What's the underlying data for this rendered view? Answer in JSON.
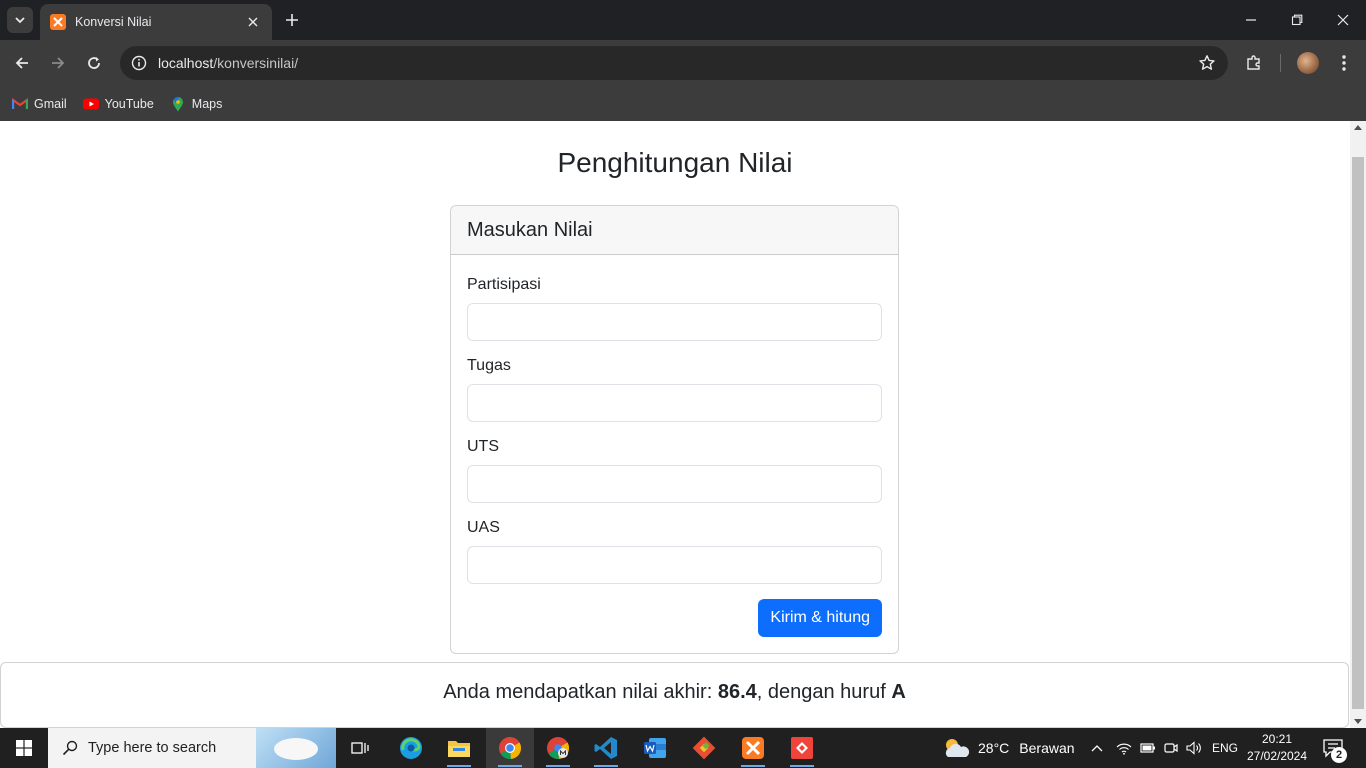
{
  "browser": {
    "tab_title": "Konversi Nilai",
    "url_host": "localhost",
    "url_path": "/konversinilai/",
    "bookmarks": [
      {
        "label": "Gmail",
        "icon": "gmail-icon"
      },
      {
        "label": "YouTube",
        "icon": "youtube-icon"
      },
      {
        "label": "Maps",
        "icon": "maps-icon"
      }
    ]
  },
  "page": {
    "title": "Penghitungan Nilai",
    "card_header": "Masukan Nilai",
    "fields": [
      {
        "label": "Partisipasi",
        "value": ""
      },
      {
        "label": "Tugas",
        "value": ""
      },
      {
        "label": "UTS",
        "value": ""
      },
      {
        "label": "UAS",
        "value": ""
      }
    ],
    "submit_label": "Kirim & hitung",
    "result": {
      "prefix": "Anda mendapatkan nilai akhir: ",
      "score": "86.4",
      "middle": ", dengan huruf ",
      "grade": "A"
    }
  },
  "taskbar": {
    "search_placeholder": "Type here to search",
    "weather_temp": "28°C",
    "weather_text": "Berawan",
    "language": "ENG",
    "time": "20:21",
    "date": "27/02/2024",
    "notification_count": "2"
  },
  "colors": {
    "primary": "#0d6efd",
    "chrome_dark": "#202124",
    "chrome_toolbar": "#3c3c3c"
  }
}
